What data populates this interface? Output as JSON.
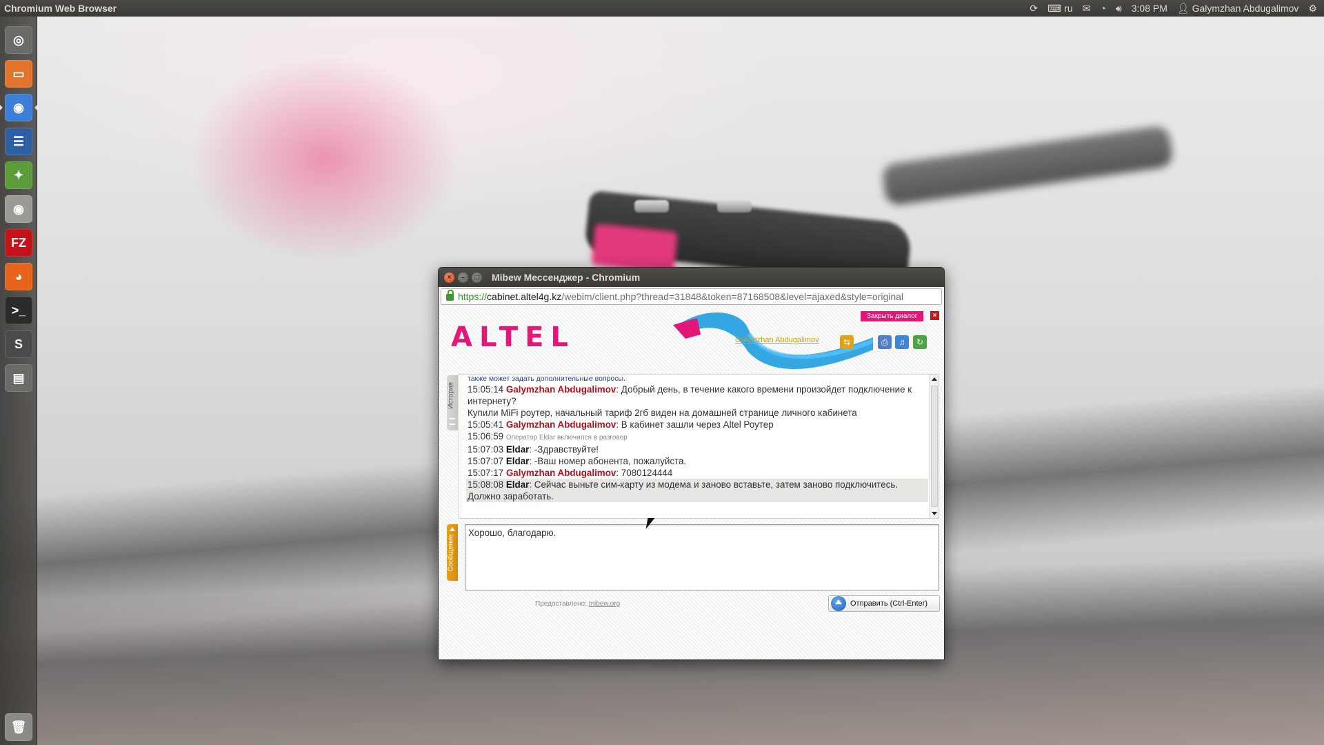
{
  "top_panel": {
    "app_title": "Chromium Web Browser",
    "keyboard_layout": "ru",
    "time": "3:08 PM",
    "user": "Galymzhan Abdugalimov"
  },
  "launcher": {
    "items": [
      {
        "name": "dash-icon",
        "glyph": "◎",
        "color": "#6b6a66"
      },
      {
        "name": "files-icon",
        "glyph": "▭",
        "color": "#e2742b"
      },
      {
        "name": "chromium-icon",
        "glyph": "◉",
        "color": "#3d7ed8"
      },
      {
        "name": "writer-icon",
        "glyph": "☰",
        "color": "#2e5fa3"
      },
      {
        "name": "sea-game-icon",
        "glyph": "✦",
        "color": "#5b9b3a"
      },
      {
        "name": "speaker-icon",
        "glyph": "◉",
        "color": "#9a9a96"
      },
      {
        "name": "filezilla-icon",
        "glyph": "FZ",
        "color": "#c4121b"
      },
      {
        "name": "firefox-icon",
        "glyph": "◕",
        "color": "#e8641b"
      },
      {
        "name": "terminal-icon",
        "glyph": ">_",
        "color": "#2b2b2b"
      },
      {
        "name": "sublime-icon",
        "glyph": "S",
        "color": "#4a4a4a"
      },
      {
        "name": "workspace-icon",
        "glyph": "▤",
        "color": "#6a6a66"
      },
      {
        "name": "trash-icon",
        "glyph": "🗑",
        "color": "#8a8a86"
      }
    ]
  },
  "window": {
    "title": "Mibew Мессенджер - Chromium",
    "url_scheme": "https://",
    "url_host": "cabinet.altel4g.kz",
    "url_rest": "/webim/client.php?thread=31848&token=87168508&level=ajaxed&style=original"
  },
  "page": {
    "logo": "ALTEL",
    "close_dialog": "Закрыть диалог",
    "close_x": "×",
    "operator_name": "Galymzhan Abdugalimov",
    "history_tab": "История",
    "message_tab": "Сообщение",
    "chat": [
      {
        "type": "note",
        "text": "также может задать дополнительные вопросы."
      },
      {
        "type": "msg",
        "time": "15:05:14",
        "name": "Galymzhan Abdugalimov",
        "role": "user",
        "text": ": Добрый день, в течение какого времени произойдет подключение к интернету?"
      },
      {
        "type": "plain",
        "text": "Купили MiFi роутер, начальный тариф 2гб виден на домашней странице личного кабинета"
      },
      {
        "type": "msg",
        "time": "15:05:41",
        "name": "Galymzhan Abdugalimov",
        "role": "user",
        "text": ": В кабинет зашли через Altel Роутер"
      },
      {
        "type": "sys",
        "time": "15:06:59",
        "text": "Оператор Eldar включился в разговор"
      },
      {
        "type": "msg",
        "time": "15:07:03",
        "name": "Eldar",
        "role": "op",
        "text": ": -Здравствуйте!"
      },
      {
        "type": "msg",
        "time": "15:07:07",
        "name": "Eldar",
        "role": "op",
        "text": ": -Ваш номер абонента, пожалуйста."
      },
      {
        "type": "msg",
        "time": "15:07:17",
        "name": "Galymzhan Abdugalimov",
        "role": "user",
        "text": ": 7080124444"
      },
      {
        "type": "msg",
        "time": "15:08:08",
        "name": "Eldar",
        "role": "op",
        "text": ": Сейчас выньте сим-карту из модема и заново вставьте, затем заново подключитесь. Должно заработать.",
        "highlight": true
      }
    ],
    "message_input": "Хорошо, благодарю.",
    "powered_by": "Предоставлено:",
    "powered_link": "mibew.org",
    "send_button": "Отправить (Ctrl-Enter)"
  },
  "colors": {
    "brand": "#e3167a",
    "user_name": "#b3121d",
    "note": "#1f3fa8"
  }
}
